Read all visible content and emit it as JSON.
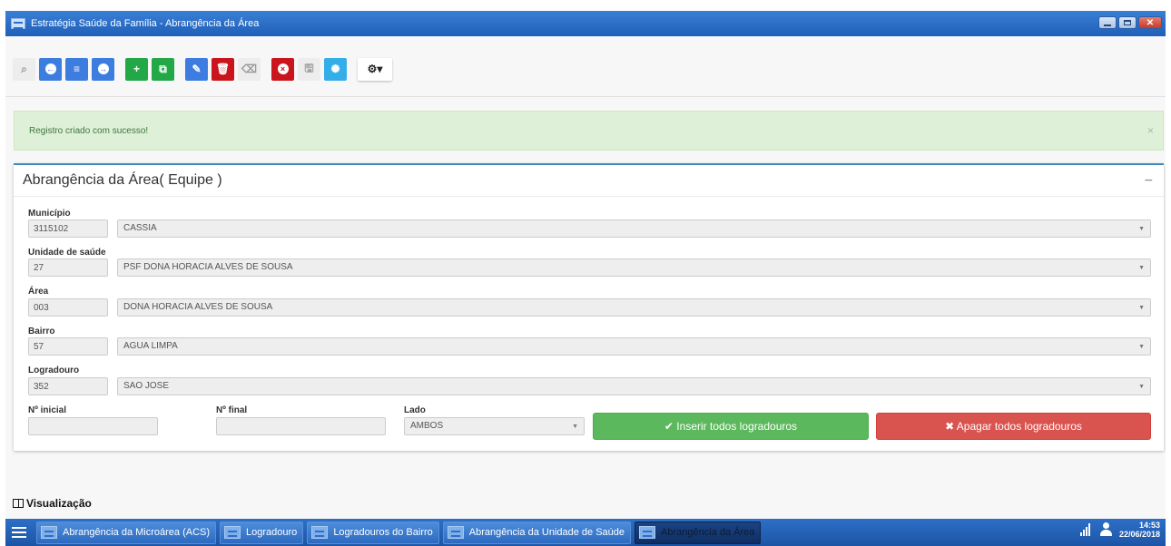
{
  "window": {
    "title": "Estratégia Saúde da Família - Abrangência da Área",
    "close_glyph": "✕"
  },
  "toolbar": {
    "buttons": [
      {
        "icon": "search-icon",
        "glyph": "⌕"
      },
      {
        "icon": "arrow-left-icon",
        "glyph": "←"
      },
      {
        "icon": "list-icon",
        "glyph": "≡"
      },
      {
        "icon": "arrow-right-icon",
        "glyph": "→"
      },
      {
        "icon": "plus-icon",
        "glyph": "+"
      },
      {
        "icon": "copy-icon",
        "glyph": "⧉"
      },
      {
        "icon": "edit-icon",
        "glyph": "✎"
      },
      {
        "icon": "trash-icon",
        "glyph": "🗑"
      },
      {
        "icon": "eraser-icon",
        "glyph": "⌫"
      },
      {
        "icon": "cancel-icon",
        "glyph": "×"
      },
      {
        "icon": "save-icon",
        "glyph": "🖫"
      },
      {
        "icon": "refresh-icon",
        "glyph": "✺"
      },
      {
        "icon": "settings-icon",
        "glyph": "⚙▾"
      }
    ]
  },
  "alert": {
    "message": "Registro criado com sucesso!",
    "close": "×"
  },
  "panel": {
    "title": "Abrangência da Área( Equipe )",
    "collapse": "−",
    "fields": {
      "municipio": {
        "label": "Município",
        "code": "3115102",
        "value": "CASSIA"
      },
      "unidade": {
        "label": "Unidade de saúde",
        "code": "27",
        "value": "PSF DONA HORACIA ALVES DE SOUSA"
      },
      "area": {
        "label": "Área",
        "code": "003",
        "value": "DONA HORACIA ALVES DE SOUSA"
      },
      "bairro": {
        "label": "Bairro",
        "code": "57",
        "value": "AGUA LIMPA"
      },
      "logradouro": {
        "label": "Logradouro",
        "code": "352",
        "value": "SAO JOSE"
      }
    },
    "numero_inicial": {
      "label": "Nº inicial",
      "value": ""
    },
    "numero_final": {
      "label": "Nº final",
      "value": ""
    },
    "lado": {
      "label": "Lado",
      "value": "AMBOS"
    },
    "caret": "▼",
    "insert_button": "✔ Inserir todos logradouros",
    "delete_button": "✖ Apagar todos logradouros"
  },
  "visualizacao": {
    "label": "Visualização"
  },
  "taskbar": {
    "tasks": [
      "Abrangência da Microárea (ACS)",
      "Logradouro",
      "Logradouros do Bairro",
      "Abrangência da Unidade de Saúde",
      "Abrangência da Área"
    ],
    "active_index": 4,
    "time": "14:53",
    "date": "22/06/2018"
  },
  "colors": {
    "accent": "#3c8dbc",
    "success": "#5cb85c",
    "danger": "#d9534f",
    "titlebar": "#1f5fb8"
  }
}
